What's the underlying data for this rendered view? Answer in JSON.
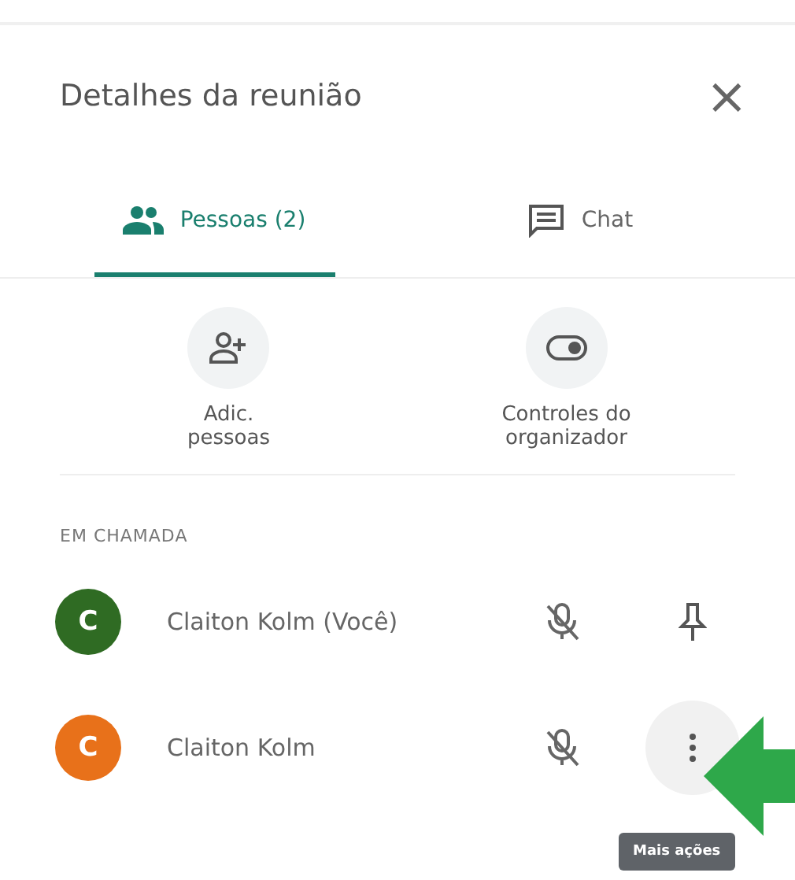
{
  "panel": {
    "title": "Detalhes da reunião",
    "close_glyph": "×"
  },
  "tabs": [
    {
      "label": "Pessoas (2)",
      "kind": "people",
      "selected": true
    },
    {
      "label": "Chat",
      "kind": "chat",
      "selected": false
    }
  ],
  "actions": [
    {
      "kind": "add-person",
      "label": "Adic.\npessoas"
    },
    {
      "kind": "toggle",
      "label": "Controles do\norganizador"
    }
  ],
  "section": "EM CHAMADA",
  "participants": [
    {
      "initial": "C",
      "name": "Claiton Kolm (Você)",
      "color": "#2f6b23",
      "muted": true,
      "kind": "pin",
      "hovered": false
    },
    {
      "initial": "C",
      "name": "Claiton Kolm",
      "color": "#e8711a",
      "muted": true,
      "kind": "more",
      "hovered": true
    }
  ],
  "tooltip": "Mais ações",
  "annotation_arrow": true
}
